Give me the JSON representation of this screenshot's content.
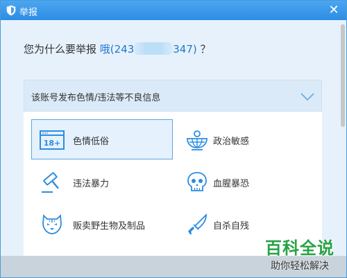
{
  "window": {
    "title": "举报",
    "close_glyph": "✕"
  },
  "question": {
    "prefix": "您为什么要举报 ",
    "account_start": "哦(243",
    "account_end": "347)",
    "suffix": " ？"
  },
  "dropdown": {
    "label": "该账号发布色情/违法等不良信息",
    "icon": "chevron-down-icon"
  },
  "options": [
    {
      "label": "色情低俗",
      "icon": "age-18-plus-icon",
      "selected": true
    },
    {
      "label": "政治敏感",
      "icon": "globe-podium-icon",
      "selected": false
    },
    {
      "label": "违法暴力",
      "icon": "gavel-icon",
      "selected": false
    },
    {
      "label": "血腥暴恐",
      "icon": "skull-icon",
      "selected": false
    },
    {
      "label": "贩卖野生物及制品",
      "icon": "tiger-face-icon",
      "selected": false
    },
    {
      "label": "自杀自残",
      "icon": "knife-icon",
      "selected": false
    }
  ],
  "icon_text": {
    "age_badge": "18+"
  },
  "watermark": {
    "main": "百科全说",
    "sub": "助你轻松解决"
  },
  "colors": {
    "accent": "#2d8ce4",
    "icon_blue": "#2b8ce0",
    "selected_border": "#5ca7e4",
    "watermark_green": "#27a244"
  }
}
